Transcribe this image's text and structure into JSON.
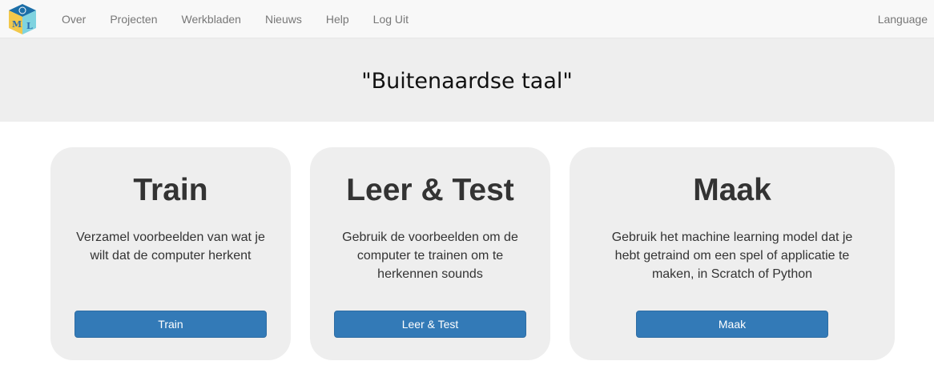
{
  "navbar": {
    "logo_icon": "ml-cube-logo-icon",
    "logo_letters": [
      "M",
      "L"
    ],
    "links": [
      "Over",
      "Projecten",
      "Werkbladen",
      "Nieuws",
      "Help",
      "Log Uit"
    ],
    "language": "Language"
  },
  "banner": {
    "title": "\"Buitenaardse taal\""
  },
  "cards": [
    {
      "heading": "Train",
      "text": "Verzamel voorbeelden van wat je wilt dat de computer herkent",
      "button": "Train"
    },
    {
      "heading": "Leer & Test",
      "text": "Gebruik de voorbeelden om de computer te trainen om te herkennen sounds",
      "button": "Leer & Test"
    },
    {
      "heading": "Maak",
      "text": "Gebruik het machine learning model dat je hebt getraind om een spel of applicatie te maken, in Scratch of Python",
      "button": "Maak"
    }
  ],
  "colors": {
    "navbar_bg": "#f8f8f8",
    "banner_bg": "#eeeeee",
    "card_bg": "#eeeeee",
    "button_bg": "#337ab7",
    "link_text": "#777777"
  }
}
